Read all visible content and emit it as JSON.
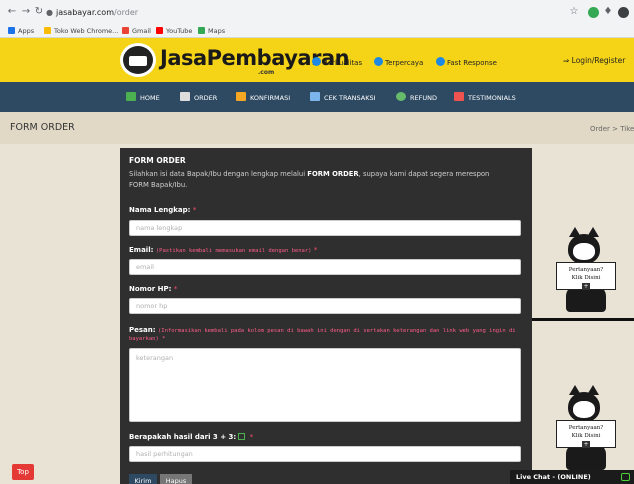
{
  "browser": {
    "url_host": "jasabayar.com",
    "url_path": "/order",
    "bookmarks": [
      "Apps",
      "Toko Web Chrome...",
      "Gmail",
      "YouTube",
      "Maps"
    ]
  },
  "header": {
    "logo_text": "JasaPembayaran",
    "logo_sub": ".com",
    "badges": [
      "Berkualitas",
      "Terpercaya",
      "Fast Response"
    ],
    "login": "Login/Register"
  },
  "menu": [
    "HOME",
    "ORDER",
    "KONFIRMASI",
    "CEK TRANSAKSI",
    "REFUND",
    "TESTIMONIALS"
  ],
  "page": {
    "title": "FORM ORDER",
    "breadcrumb": "Order  >  Tiket"
  },
  "form": {
    "heading": "FORM ORDER",
    "desc_pre": "Silahkan isi data Bapak/Ibu dengan lengkap melalui ",
    "desc_bold": "FORM ORDER",
    "desc_post": ", supaya kami dapat segera merespon FORM Bapak/Ibu.",
    "name_label": "Nama Lengkap:",
    "name_placeholder": "nama lengkap",
    "email_label": "Email:",
    "email_note": "(Pastikan kembali memasukan email dengan benar)",
    "email_placeholder": "email",
    "phone_label": "Nomor HP:",
    "phone_placeholder": "nomor hp",
    "message_label": "Pesan:",
    "message_note": "(Informasikan kembali pada kolom pesan di bawah ini dengan di sertakan keterangan dan link web yang ingin di",
    "message_note2": "bayarkan)",
    "message_placeholder": "keterangan",
    "captcha_label": "Berapakah hasil dari 3 + 3:",
    "captcha_placeholder": "hasil perhitungan",
    "submit": "Kirim",
    "reset": "Hapus",
    "required": "*"
  },
  "widgets": {
    "sign_line1": "Pertanyaan?",
    "sign_line2": "Klik Disini",
    "top": "Top",
    "livechat": "Live Chat - (ONLINE)"
  },
  "colors": {
    "header_bg": "#f5d418",
    "menu_bg": "#2e4a63",
    "panel_bg": "#2f2f2f",
    "submit_bg": "#2e4a63",
    "reset_bg": "#777777",
    "accent_red": "#e53935"
  }
}
